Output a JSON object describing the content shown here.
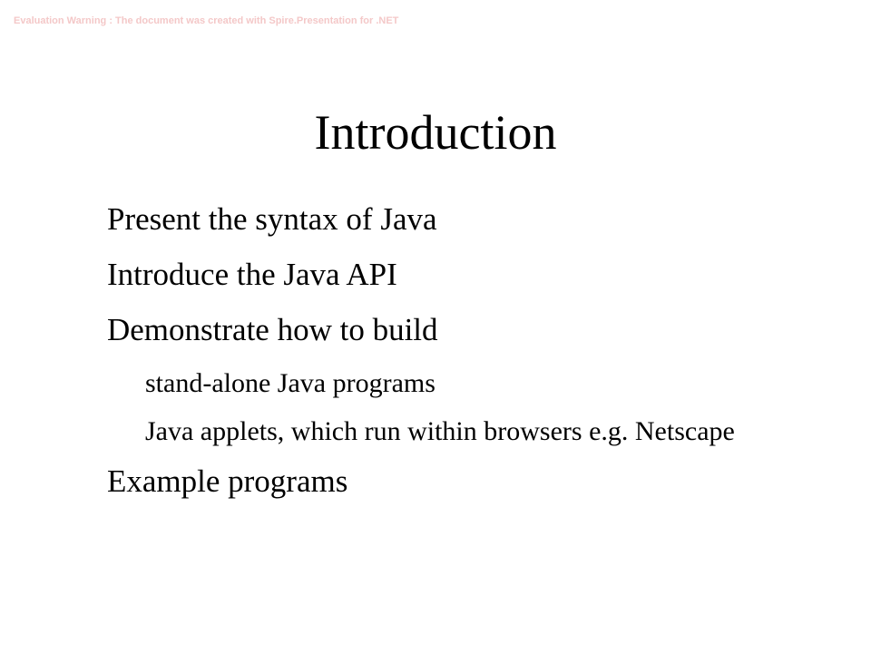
{
  "watermark": "Evaluation Warning : The document was created with  Spire.Presentation for .NET",
  "slide": {
    "title": "Introduction",
    "bullets": [
      "Present the syntax of Java",
      "Introduce the Java API",
      "Demonstrate how to build"
    ],
    "sub_bullets": [
      "stand-alone Java programs",
      "Java applets, which run within browsers e.g. Netscape"
    ],
    "last_bullet": "Example programs"
  }
}
